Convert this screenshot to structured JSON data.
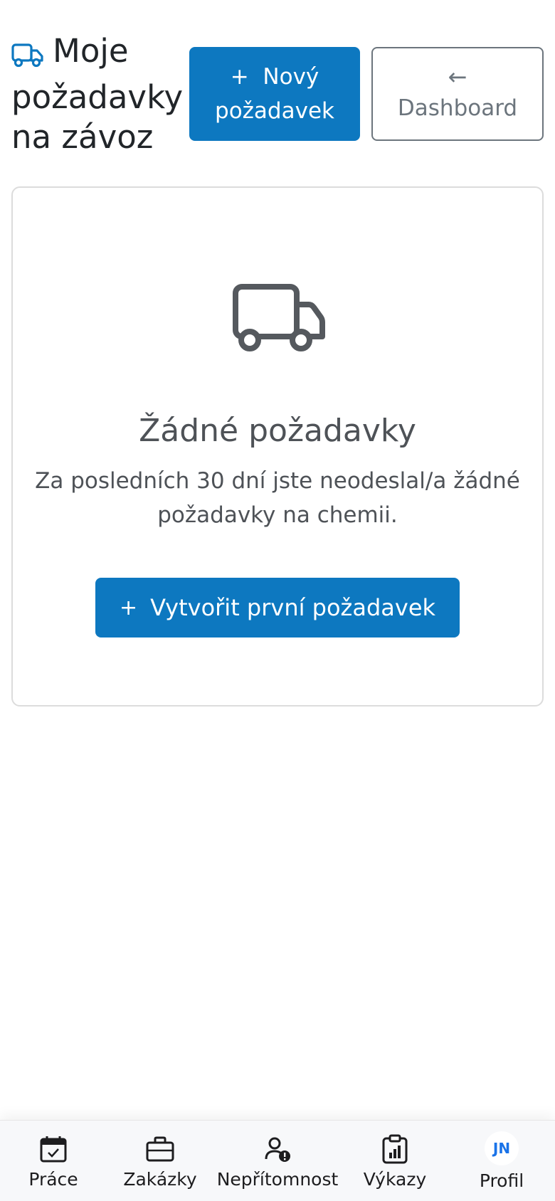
{
  "header": {
    "title": "Moje požadavky na závoz",
    "new_request_plus": "+",
    "new_request_label": "Nový požadavek",
    "dashboard_arrow": "←",
    "dashboard_label": "Dashboard"
  },
  "empty_state": {
    "icon": "truck-icon",
    "title": "Žádné požadavky",
    "text": "Za posledních 30 dní jste neodeslal/a žádné požadavky na chemii.",
    "cta_plus": "+",
    "cta_label": "Vytvořit první požadavek"
  },
  "bottom_nav": {
    "items": [
      {
        "label": "Práce",
        "icon": "calendar-check-icon"
      },
      {
        "label": "Zakázky",
        "icon": "briefcase-icon"
      },
      {
        "label": "Nepřítomnost",
        "icon": "person-alert-icon"
      },
      {
        "label": "Výkazy",
        "icon": "clipboard-chart-icon"
      },
      {
        "label": "Profil",
        "avatar_initials": "JN"
      }
    ]
  },
  "colors": {
    "primary": "#0d78c0",
    "muted_text": "#4e5257",
    "outline": "#6c757d",
    "avatar_text": "#1a73e8"
  }
}
